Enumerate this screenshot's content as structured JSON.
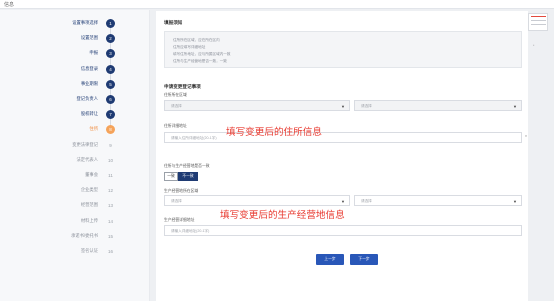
{
  "window": {
    "title": "信息"
  },
  "steps": [
    {
      "label": "设置事项选择",
      "num": "1",
      "state": "done"
    },
    {
      "label": "设置范围",
      "num": "2",
      "state": "done"
    },
    {
      "label": "申报",
      "num": "3",
      "state": "done"
    },
    {
      "label": "信息登录",
      "num": "4",
      "state": "done"
    },
    {
      "label": "事业期限",
      "num": "5",
      "state": "done"
    },
    {
      "label": "登记负责人",
      "num": "6",
      "state": "done"
    },
    {
      "label": "股权转让",
      "num": "7",
      "state": "done"
    },
    {
      "label": "住所",
      "num": "8",
      "state": "current"
    },
    {
      "label": "变更法律登记",
      "num": "9",
      "state": "pending"
    },
    {
      "label": "法定代表人",
      "num": "10",
      "state": "pending"
    },
    {
      "label": "董事会",
      "num": "11",
      "state": "pending"
    },
    {
      "label": "企业类型",
      "num": "12",
      "state": "pending"
    },
    {
      "label": "经营范围",
      "num": "13",
      "state": "pending"
    },
    {
      "label": "材料上传",
      "num": "14",
      "state": "pending"
    },
    {
      "label": "承诺书/委托书",
      "num": "15",
      "state": "pending"
    },
    {
      "label": "签名认证",
      "num": "16",
      "state": "pending"
    }
  ],
  "main": {
    "notice_title": "填报须知",
    "notice_lines": [
      "住所所在区域，应在所在区内",
      "住所应填写详细地址",
      "填写住所地址，应与所属区域内一致",
      "住所与生产经营地是否一致，一致"
    ],
    "section_title": "申请变更登记事项",
    "residence_region_label": "住所所在区域",
    "region_select_1": "请选择",
    "region_select_2": "请选择",
    "residence_address_label": "住所详细地址",
    "residence_address_placeholder": "请输入住所详细地址(20-1字)",
    "same_question_label": "住所与生产经营地是否一致",
    "yes_label": "一致",
    "no_label": "不一致",
    "biz_region_label": "生产经营地所在区域",
    "biz_select_1": "请选择",
    "biz_select_2": "请选择",
    "biz_address_label": "生产经营详细地址",
    "biz_address_placeholder": "请输入详细地址(20-1字)",
    "prev_button": "上一步",
    "next_button": "下一步",
    "annotation_residence": "填写变更后的住所信息",
    "annotation_business": "填写变更后的生产经营地信息",
    "required_mark": "*"
  },
  "colors": {
    "primary": "#2957b8",
    "step_done": "#1f3b73",
    "step_current": "#f5a35a",
    "annotation": "#e8392f"
  }
}
